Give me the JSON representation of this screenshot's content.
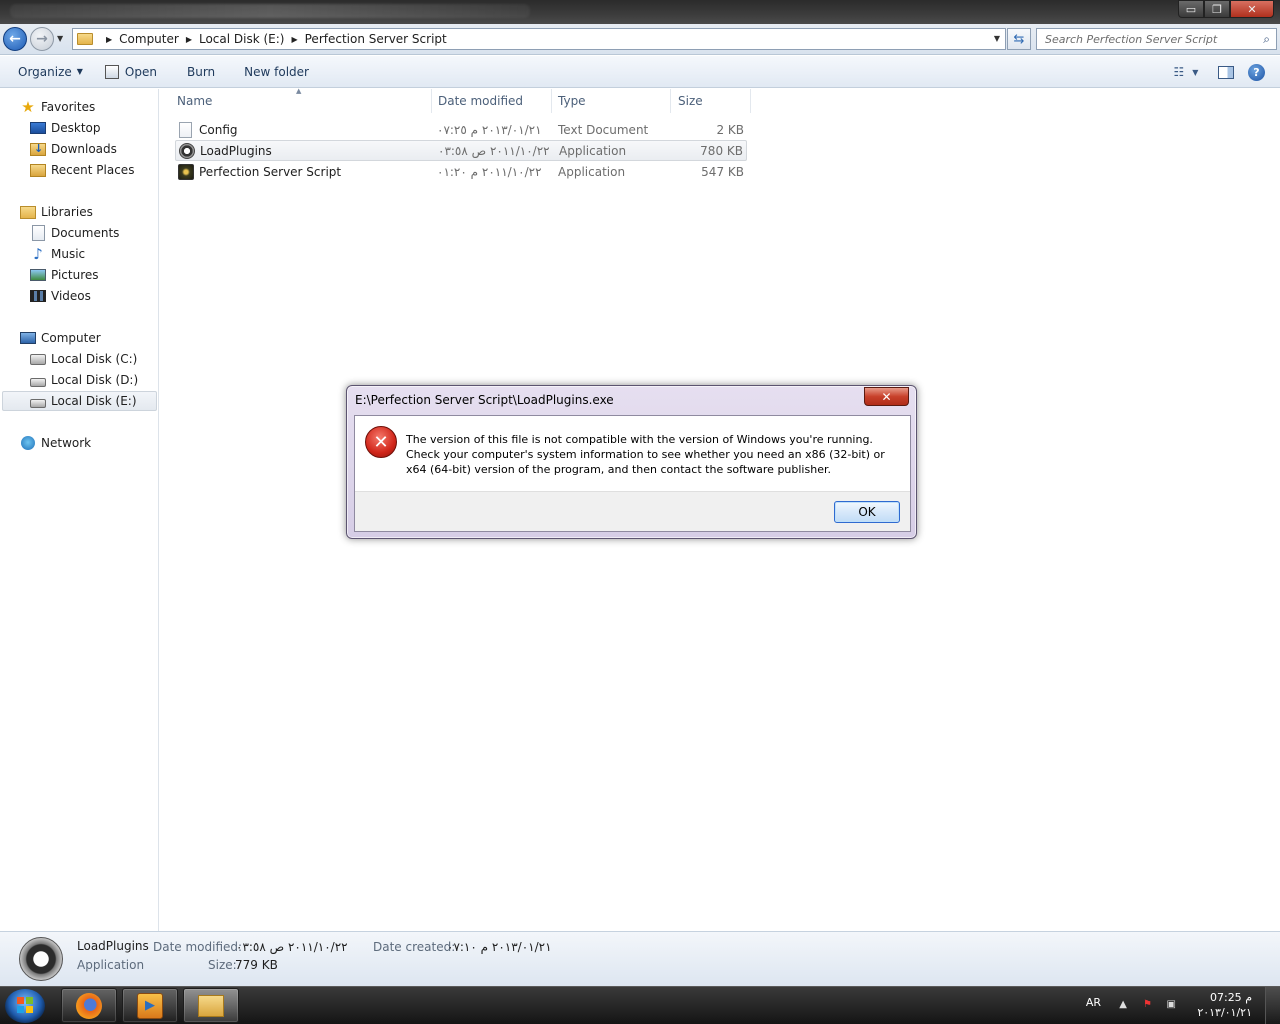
{
  "window": {
    "controls": {
      "minimize": "▭",
      "maximize": "❐",
      "close": "✕"
    }
  },
  "address": {
    "crumbs": [
      "Computer",
      "Local Disk (E:)",
      "Perfection Server Script"
    ],
    "search_placeholder": "Search Perfection Server Script"
  },
  "toolbar": {
    "organize": "Organize",
    "open": "Open",
    "burn": "Burn",
    "new_folder": "New folder"
  },
  "nav": {
    "favorites": {
      "label": "Favorites",
      "items": [
        "Desktop",
        "Downloads",
        "Recent Places"
      ]
    },
    "libraries": {
      "label": "Libraries",
      "items": [
        "Documents",
        "Music",
        "Pictures",
        "Videos"
      ]
    },
    "computer": {
      "label": "Computer",
      "items": [
        "Local Disk (C:)",
        "Local Disk (D:)",
        "Local Disk (E:)"
      ]
    },
    "network": {
      "label": "Network"
    },
    "selected": "Local Disk (E:)"
  },
  "columns": {
    "name": "Name",
    "date": "Date modified",
    "type": "Type",
    "size": "Size"
  },
  "files": [
    {
      "name": "Config",
      "date": "٢٠١٣/٠١/٢١ م ٠٧:٢٥",
      "type": "Text Document",
      "size": "2 KB",
      "icon": "text-file-icon"
    },
    {
      "name": "LoadPlugins",
      "date": "٢٠١١/١٠/٢٢ ص ٠٣:٥٨",
      "type": "Application",
      "size": "780 KB",
      "icon": "autoit-app-icon"
    },
    {
      "name": "Perfection Server Script",
      "date": "٢٠١١/١٠/٢٢ م ٠١:٢٠",
      "type": "Application",
      "size": "547 KB",
      "icon": "script-app-icon"
    }
  ],
  "details": {
    "name": "LoadPlugins",
    "kind": "Application",
    "date_modified_label": "Date modified:",
    "date_modified": "٢٠١١/١٠/٢٢ ص ٠٣:٥٨",
    "date_created_label": "Date created:",
    "date_created": "٢٠١٣/٠١/٢١ م ٠٧:١٠",
    "size_label": "Size:",
    "size": "779 KB"
  },
  "dialog": {
    "title": "E:\\Perfection Server Script\\LoadPlugins.exe",
    "message": "The version of this file is not compatible with the version of Windows you're running. Check your computer's system information to see whether you need an x86 (32-bit) or x64 (64-bit) version of the program, and then contact the software publisher.",
    "ok": "OK"
  },
  "taskbar": {
    "lang": "AR",
    "time": "07:25 م",
    "date": "٢٠١٣/٠١/٢١"
  }
}
